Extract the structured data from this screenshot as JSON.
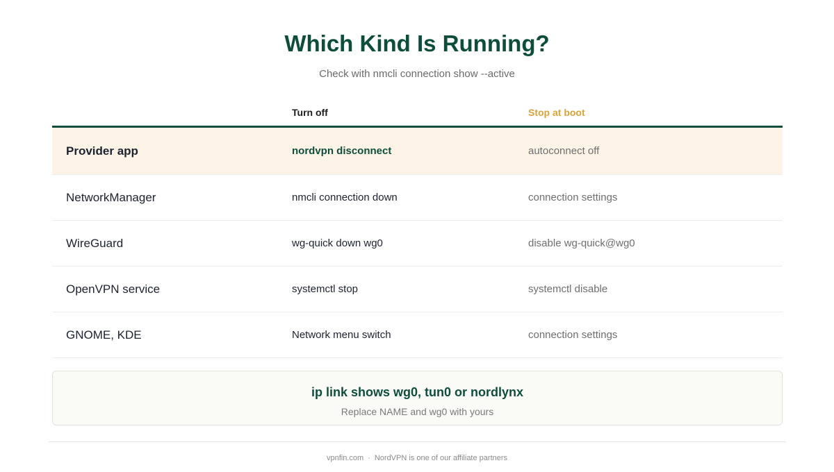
{
  "header": {
    "title": "Which Kind Is Running?",
    "subtitle": "Check with nmcli connection show --active"
  },
  "table": {
    "columns": [
      "",
      "Turn off",
      "Stop at boot"
    ],
    "rows": [
      {
        "name": "Provider app",
        "turn_off": "nordvpn disconnect",
        "stop_at_boot": "autoconnect off",
        "highlighted": true
      },
      {
        "name": "NetworkManager",
        "turn_off": "nmcli connection down",
        "stop_at_boot": "connection settings"
      },
      {
        "name": "WireGuard",
        "turn_off": "wg-quick down wg0",
        "stop_at_boot": "disable wg-quick@wg0"
      },
      {
        "name": "OpenVPN service",
        "turn_off": "systemctl stop",
        "stop_at_boot": "systemctl disable"
      },
      {
        "name": "GNOME, KDE",
        "turn_off": "Network menu switch",
        "stop_at_boot": "connection settings"
      }
    ]
  },
  "callout": {
    "title": "ip link shows wg0, tun0 or nordlynx",
    "subtitle": "Replace NAME and wg0 with yours"
  },
  "footer": {
    "site": "vpnfin.com",
    "separator": "·",
    "disclosure": "NordVPN is one of our affiliate partners"
  },
  "colors": {
    "primary": "#0e4d3c",
    "accent": "#d9a23a",
    "highlight_row": "#fdf4e7"
  }
}
